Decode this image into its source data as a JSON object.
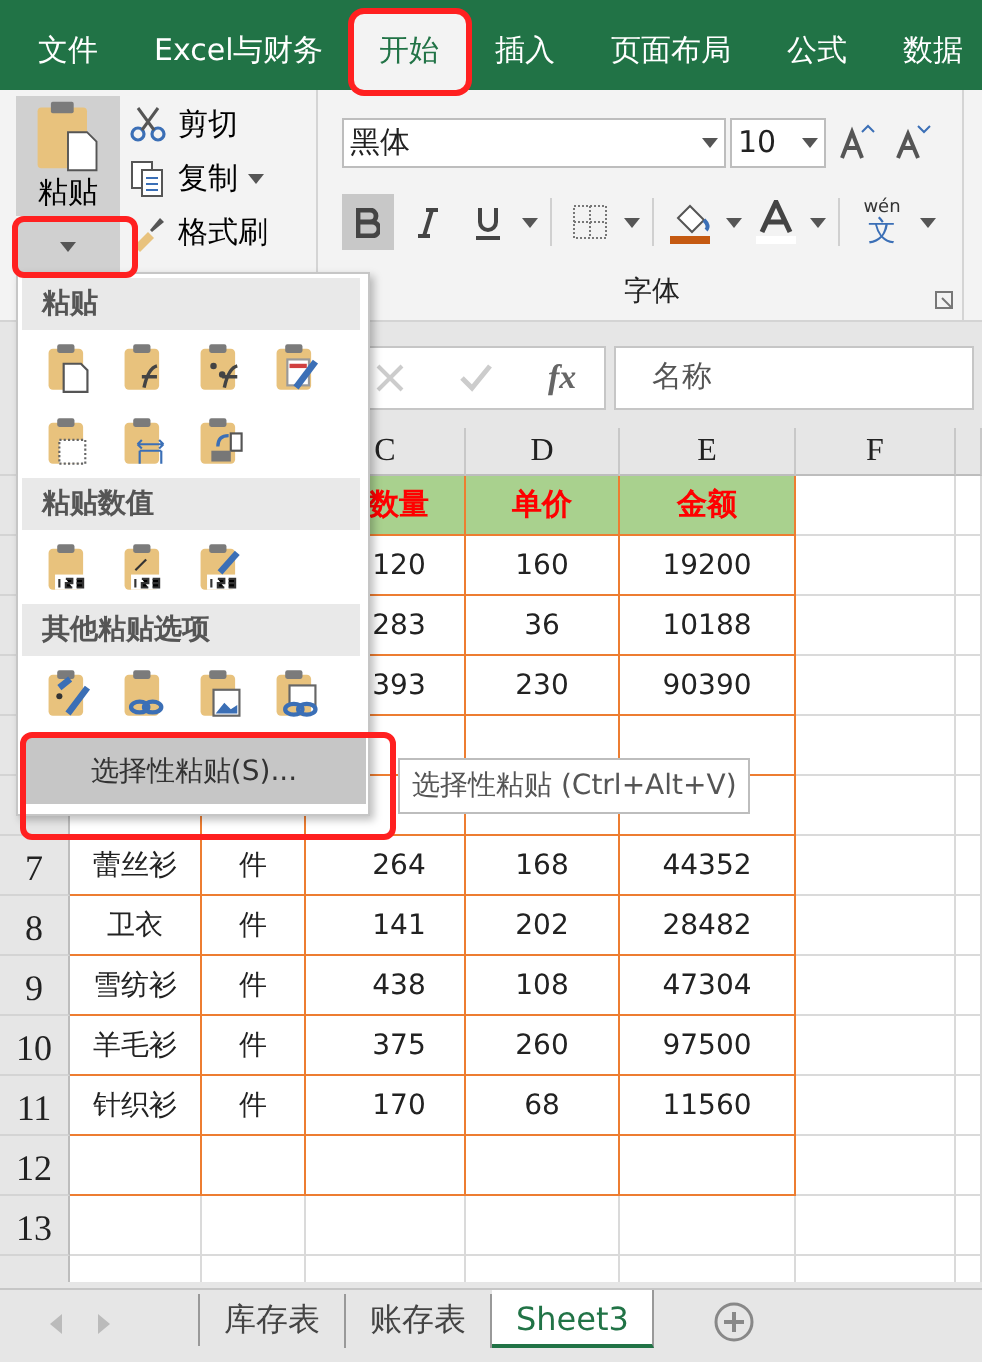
{
  "menu_tabs": [
    {
      "label": "文件",
      "selected": false,
      "highlighted": false
    },
    {
      "label": "Excel与财务",
      "selected": false,
      "highlighted": false
    },
    {
      "label": "开始",
      "selected": true,
      "highlighted": true
    },
    {
      "label": "插入",
      "selected": false,
      "highlighted": false
    },
    {
      "label": "页面布局",
      "selected": false,
      "highlighted": false
    },
    {
      "label": "公式",
      "selected": false,
      "highlighted": false
    },
    {
      "label": "数据",
      "selected": false,
      "highlighted": false
    }
  ],
  "clipboard": {
    "paste": "粘贴",
    "dropdown_highlighted": true,
    "cut": "剪切",
    "copy": "复制",
    "format_painter": "格式刷"
  },
  "font": {
    "name": "黑体",
    "size": "10",
    "bold": true,
    "group_label": "字体",
    "phonetic": "wén",
    "phonetic_char": "文"
  },
  "formula_bar": {
    "value": "名称",
    "fx": "fx"
  },
  "columns": [
    "C",
    "D",
    "E",
    "F"
  ],
  "rows": [
    {
      "bordered": true,
      "header": true,
      "cells": {
        "C": "数量",
        "D": "单价",
        "E": "金额"
      }
    },
    {
      "bordered": true,
      "header": false,
      "cells": {
        "C": "120",
        "D": "160",
        "E": "19200"
      }
    },
    {
      "bordered": true,
      "header": false,
      "cells": {
        "C": "283",
        "D": "36",
        "E": "10188"
      }
    },
    {
      "bordered": true,
      "header": false,
      "cells": {
        "C": "393",
        "D": "230",
        "E": "90390"
      }
    },
    {
      "bordered": true,
      "header": false,
      "cells": {}
    },
    {
      "bordered": true,
      "header": false,
      "cells": {}
    },
    {
      "number": "7",
      "bordered": true,
      "header": false,
      "cells": {
        "A": "蕾丝衫",
        "B": "件",
        "C": "264",
        "D": "168",
        "E": "44352"
      }
    },
    {
      "number": "8",
      "bordered": true,
      "header": false,
      "cells": {
        "A": "卫衣",
        "B": "件",
        "C": "141",
        "D": "202",
        "E": "28482"
      }
    },
    {
      "number": "9",
      "bordered": true,
      "header": false,
      "cells": {
        "A": "雪纺衫",
        "B": "件",
        "C": "438",
        "D": "108",
        "E": "47304"
      }
    },
    {
      "number": "10",
      "bordered": true,
      "header": false,
      "cells": {
        "A": "羊毛衫",
        "B": "件",
        "C": "375",
        "D": "260",
        "E": "97500"
      }
    },
    {
      "number": "11",
      "bordered": true,
      "header": false,
      "cells": {
        "A": "针织衫",
        "B": "件",
        "C": "170",
        "D": "68",
        "E": "11560"
      }
    },
    {
      "number": "12",
      "bordered": true,
      "header": false,
      "cells": {}
    },
    {
      "number": "13",
      "bordered": false,
      "header": false,
      "cells": {}
    }
  ],
  "sheet_tabs": [
    {
      "label": "库存表",
      "selected": false
    },
    {
      "label": "账存表",
      "selected": false
    },
    {
      "label": "Sheet3",
      "selected": true
    }
  ],
  "paste_menu": {
    "sections": [
      {
        "title": "粘贴"
      },
      {
        "title": "粘贴数值"
      },
      {
        "title": "其他粘贴选项"
      }
    ],
    "special_item": {
      "label": "选择性粘贴(S)...",
      "highlighted": true
    },
    "tooltip": "选择性粘贴 (Ctrl+Alt+V)"
  }
}
